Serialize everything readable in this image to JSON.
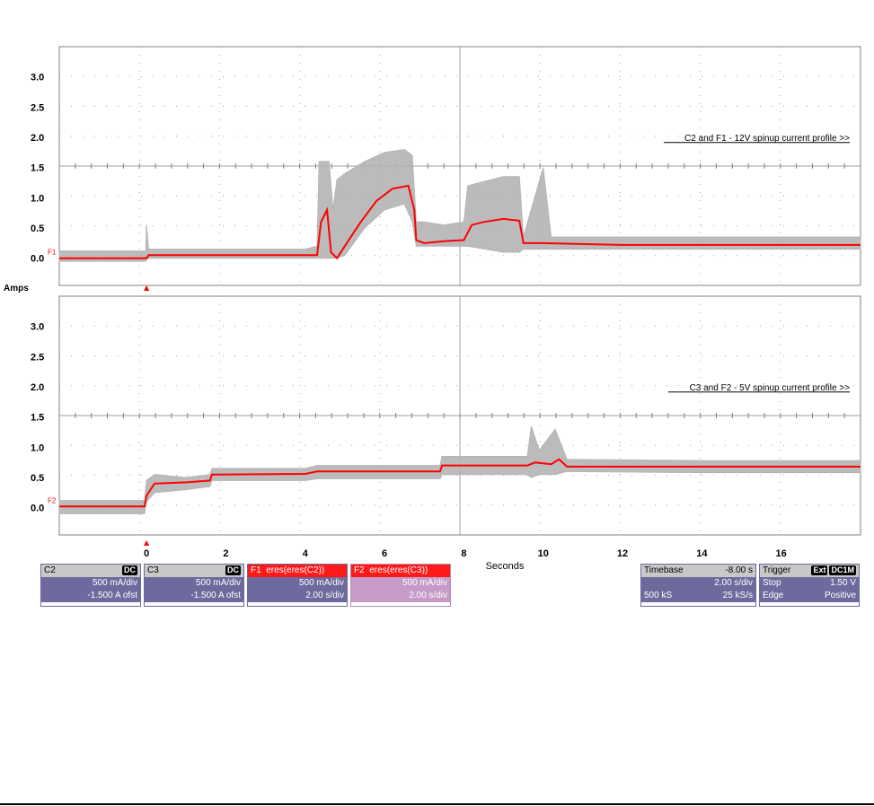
{
  "chart_data": [
    {
      "type": "line",
      "title": "C2 and F1 - 12V spinup current profile >>",
      "ylabel": "Amps",
      "xlabel": "Seconds",
      "xlim": [
        -2.2,
        18
      ],
      "ylim": [
        -0.45,
        3.5
      ],
      "yticks": [
        0.0,
        0.5,
        1.0,
        1.5,
        2.0,
        2.5,
        3.0
      ],
      "trace_marker": "F1",
      "series": [
        {
          "name": "C2",
          "color": "#b4b4b4",
          "envelope": [
            [
              -2.2,
              -0.05,
              0.12
            ],
            [
              -0.02,
              -0.05,
              0.12
            ],
            [
              0.0,
              -0.02,
              0.55
            ],
            [
              0.05,
              0.0,
              0.15
            ],
            [
              2.0,
              0.0,
              0.15
            ],
            [
              4.0,
              0.0,
              0.15
            ],
            [
              4.3,
              0.0,
              0.2
            ],
            [
              4.35,
              0.0,
              1.6
            ],
            [
              4.6,
              0.0,
              1.6
            ],
            [
              4.7,
              0.0,
              0.8
            ],
            [
              4.8,
              0.0,
              1.3
            ],
            [
              5.0,
              0.05,
              1.4
            ],
            [
              5.5,
              0.5,
              1.6
            ],
            [
              6.0,
              0.8,
              1.75
            ],
            [
              6.5,
              0.9,
              1.8
            ],
            [
              6.7,
              0.6,
              1.7
            ],
            [
              6.8,
              0.2,
              0.6
            ],
            [
              7.0,
              0.2,
              0.6
            ],
            [
              7.5,
              0.2,
              0.55
            ],
            [
              8.0,
              0.2,
              0.6
            ],
            [
              8.1,
              0.2,
              1.2
            ],
            [
              9.0,
              0.1,
              1.35
            ],
            [
              9.4,
              0.1,
              1.35
            ],
            [
              9.5,
              0.15,
              0.35
            ],
            [
              10.0,
              0.15,
              1.5
            ],
            [
              10.2,
              0.15,
              0.35
            ],
            [
              14.0,
              0.15,
              0.35
            ],
            [
              18.0,
              0.15,
              0.35
            ]
          ]
        },
        {
          "name": "F1",
          "color": "#ff0000",
          "points": [
            [
              -2.2,
              0.0
            ],
            [
              0.0,
              0.0
            ],
            [
              0.05,
              0.05
            ],
            [
              2.0,
              0.05
            ],
            [
              4.0,
              0.05
            ],
            [
              4.3,
              0.05
            ],
            [
              4.4,
              0.6
            ],
            [
              4.55,
              0.8
            ],
            [
              4.65,
              0.1
            ],
            [
              4.8,
              0.0
            ],
            [
              5.0,
              0.2
            ],
            [
              5.4,
              0.6
            ],
            [
              5.8,
              0.95
            ],
            [
              6.2,
              1.15
            ],
            [
              6.6,
              1.2
            ],
            [
              6.75,
              0.8
            ],
            [
              6.8,
              0.3
            ],
            [
              7.0,
              0.25
            ],
            [
              7.5,
              0.28
            ],
            [
              8.0,
              0.3
            ],
            [
              8.2,
              0.55
            ],
            [
              8.5,
              0.6
            ],
            [
              9.0,
              0.65
            ],
            [
              9.4,
              0.62
            ],
            [
              9.5,
              0.25
            ],
            [
              10.0,
              0.25
            ],
            [
              12.0,
              0.22
            ],
            [
              18.0,
              0.22
            ]
          ]
        }
      ]
    },
    {
      "type": "line",
      "title": "C3 and F2 - 5V spinup current profile >>",
      "ylabel": "Amps",
      "xlabel": "Seconds",
      "xlim": [
        -2.2,
        18
      ],
      "ylim": [
        -0.45,
        3.5
      ],
      "yticks": [
        0.0,
        0.5,
        1.0,
        1.5,
        2.0,
        2.5,
        3.0
      ],
      "xticks": [
        0,
        2,
        4,
        6,
        8,
        10,
        12,
        14,
        16
      ],
      "trace_marker": "F2",
      "series": [
        {
          "name": "C3",
          "color": "#b4b4b4",
          "envelope": [
            [
              -2.2,
              -0.1,
              0.12
            ],
            [
              -0.05,
              -0.1,
              0.12
            ],
            [
              0.0,
              0.1,
              0.45
            ],
            [
              0.2,
              0.25,
              0.55
            ],
            [
              1.0,
              0.3,
              0.5
            ],
            [
              1.6,
              0.35,
              0.55
            ],
            [
              1.65,
              0.45,
              0.65
            ],
            [
              4.0,
              0.45,
              0.65
            ],
            [
              4.3,
              0.48,
              0.7
            ],
            [
              7.4,
              0.48,
              0.7
            ],
            [
              7.45,
              0.55,
              0.85
            ],
            [
              9.6,
              0.55,
              0.85
            ],
            [
              9.7,
              0.5,
              1.35
            ],
            [
              9.9,
              0.55,
              0.95
            ],
            [
              10.3,
              0.55,
              1.3
            ],
            [
              10.6,
              0.6,
              0.8
            ],
            [
              14.0,
              0.58,
              0.78
            ],
            [
              18.0,
              0.58,
              0.78
            ]
          ]
        },
        {
          "name": "F2",
          "color": "#ff0000",
          "points": [
            [
              -2.2,
              0.02
            ],
            [
              -0.05,
              0.02
            ],
            [
              0.0,
              0.2
            ],
            [
              0.2,
              0.4
            ],
            [
              1.0,
              0.42
            ],
            [
              1.6,
              0.45
            ],
            [
              1.65,
              0.55
            ],
            [
              4.0,
              0.56
            ],
            [
              4.3,
              0.6
            ],
            [
              7.4,
              0.6
            ],
            [
              7.45,
              0.7
            ],
            [
              9.6,
              0.7
            ],
            [
              9.8,
              0.75
            ],
            [
              10.2,
              0.72
            ],
            [
              10.4,
              0.8
            ],
            [
              10.6,
              0.68
            ],
            [
              18.0,
              0.68
            ]
          ]
        }
      ]
    }
  ],
  "channels": [
    {
      "name": "C2",
      "coupling": "DC",
      "scale": "500 mA/div",
      "offset": "-1.500 A ofst"
    },
    {
      "name": "C3",
      "coupling": "DC",
      "scale": "500 mA/div",
      "offset": "-1.500 A ofst"
    }
  ],
  "math": [
    {
      "name": "F1",
      "function": "eres(eres(C2))",
      "scale": "500 mA/div",
      "timebase": "2.00 s/div"
    },
    {
      "name": "F2",
      "function": "eres(eres(C3))",
      "scale": "500 mA/div",
      "timebase": "2.00 s/div"
    }
  ],
  "timebase": {
    "label": "Timebase",
    "delay": "-8.00 s",
    "scale": "2.00 s/div",
    "samples": "500 kS",
    "rate": "25 kS/s"
  },
  "trigger": {
    "label": "Trigger",
    "source": "Ext",
    "coupling": "DC1M",
    "mode": "Stop",
    "level": "1.50 V",
    "type": "Edge",
    "slope": "Positive"
  },
  "colors": {
    "raw_trace": "#b4b4b4",
    "filtered_trace": "#ff0000",
    "grid": "#808080",
    "badge": "#6e6a9e"
  }
}
